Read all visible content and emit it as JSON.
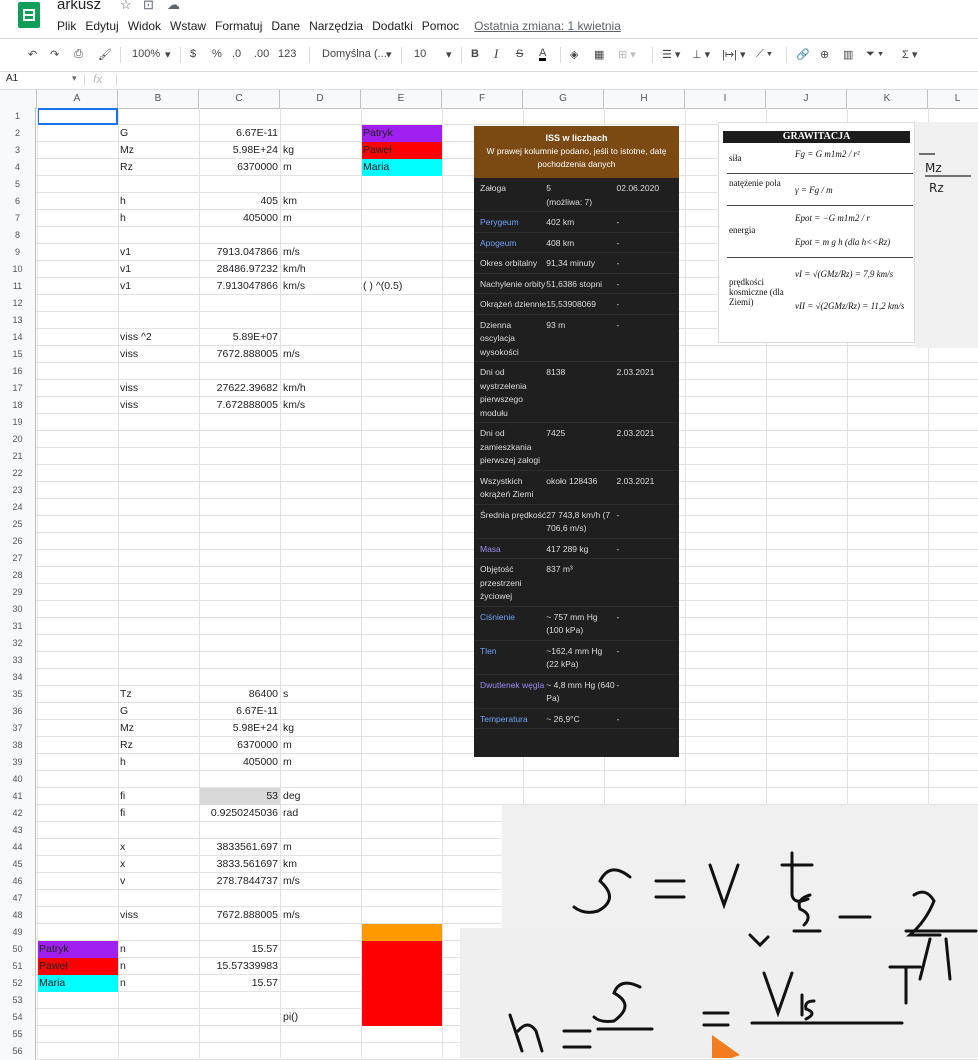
{
  "doc": {
    "title": "arkusz",
    "last_change": "Ostatnia zmiana: 1 kwietnia",
    "menu": [
      "Plik",
      "Edytuj",
      "Widok",
      "Wstaw",
      "Formatuj",
      "Dane",
      "Narzędzia",
      "Dodatki",
      "Pomoc"
    ]
  },
  "toolbar": {
    "zoom": "100%",
    "currency": "$",
    "percent": "%",
    "dec_less": ".0",
    "dec_more": ".00",
    "format_more": "123",
    "font": "Domyślna (...",
    "font_size": "10",
    "bold": "B",
    "italic": "I",
    "strike": "S",
    "text_color": "A",
    "sum": "Σ"
  },
  "formula_bar": {
    "cell_ref": "A1",
    "fx": "fx"
  },
  "columns": [
    "A",
    "B",
    "C",
    "D",
    "E",
    "F",
    "G",
    "H",
    "I",
    "J",
    "K",
    "L"
  ],
  "rows": [
    "1",
    "2",
    "3",
    "4",
    "5",
    "6",
    "7",
    "8",
    "9",
    "10",
    "11",
    "12",
    "13",
    "14",
    "15",
    "16",
    "17",
    "18",
    "19",
    "20",
    "21",
    "22",
    "23",
    "24",
    "25",
    "26",
    "27",
    "28",
    "29",
    "30",
    "31",
    "32",
    "33",
    "34",
    "35",
    "36",
    "37",
    "38",
    "39",
    "40",
    "41",
    "42",
    "43",
    "44",
    "45",
    "46",
    "47",
    "48",
    "49",
    "50",
    "51",
    "52",
    "53",
    "54",
    "55",
    "56"
  ],
  "cells": {
    "r2": {
      "b": "G",
      "c": "6.67E-11",
      "d": "",
      "e": "Patryk"
    },
    "r3": {
      "b": "Mz",
      "c": "5.98E+24",
      "d": "kg",
      "e": "Paweł"
    },
    "r4": {
      "b": "Rz",
      "c": "6370000",
      "d": "m",
      "e": "Maria"
    },
    "r6": {
      "b": "h",
      "c": "405",
      "d": "km"
    },
    "r7": {
      "b": "h",
      "c": "405000",
      "d": "m"
    },
    "r9": {
      "b": "v1",
      "c": "7913.047866",
      "d": "m/s"
    },
    "r10": {
      "b": "v1",
      "c": "28486.97232",
      "d": "km/h"
    },
    "r11": {
      "b": "v1",
      "c": "7.913047866",
      "d": "km/s",
      "e": "(     ) ^(0.5)"
    },
    "r14": {
      "b": "viss ^2",
      "c": "5.89E+07"
    },
    "r15": {
      "b": "viss",
      "c": "7672.888005",
      "d": "m/s"
    },
    "r17": {
      "b": "viss",
      "c": "27622.39682",
      "d": "km/h"
    },
    "r18": {
      "b": "viss",
      "c": "7.672888005",
      "d": "km/s"
    },
    "r35": {
      "b": "Tz",
      "c": "86400",
      "d": "s"
    },
    "r36": {
      "b": "G",
      "c": "6.67E-11"
    },
    "r37": {
      "b": "Mz",
      "c": "5.98E+24",
      "d": "kg"
    },
    "r38": {
      "b": "Rz",
      "c": "6370000",
      "d": "m"
    },
    "r39": {
      "b": "h",
      "c": "405000",
      "d": "m"
    },
    "r41": {
      "b": "fi",
      "c": "53",
      "d": "deg"
    },
    "r42": {
      "b": "fi",
      "c": "0.9250245036",
      "d": "rad"
    },
    "r44": {
      "b": "x",
      "c": "3833561.697",
      "d": "m"
    },
    "r45": {
      "b": "x",
      "c": "3833.561697",
      "d": "km"
    },
    "r46": {
      "b": "v",
      "c": "278.7844737",
      "d": "m/s"
    },
    "r48": {
      "b": "viss",
      "c": "7672.888005",
      "d": "m/s"
    },
    "r50": {
      "a": "Patryk",
      "b": "n",
      "c": "15.57"
    },
    "r51": {
      "a": "Paweł",
      "b": "n",
      "c": "15.57339983"
    },
    "r52": {
      "a": "Maria",
      "b": "n",
      "c": "15.57"
    },
    "r54": {
      "d": "pi()"
    }
  },
  "colors": {
    "violet": "#a020f0",
    "red": "#ff0000",
    "cyan": "#00ffff",
    "orange": "#ff9900",
    "gray": "#d9d9d9"
  },
  "iss": {
    "title": "ISS w liczbach",
    "subtitle": "W prawej kolumnie podano, jeśli to istotne, datę pochodzenia danych",
    "rows": [
      {
        "label": "Załoga",
        "value": "5",
        "note": "(możliwa: 7)",
        "date": "02.06.2020"
      },
      {
        "label": "Perygeum",
        "value": "402 km",
        "date": "-"
      },
      {
        "label": "Apogeum",
        "value": "408 km",
        "date": "-"
      },
      {
        "label": "Okres orbitalny",
        "value": "91,34 minuty",
        "date": "-"
      },
      {
        "label": "Nachylenie orbity",
        "value": "51,6386 stopni",
        "date": "-"
      },
      {
        "label": "Okrążeń dziennie",
        "value": "15,53908069",
        "date": "-"
      },
      {
        "label": "Dzienna oscylacja wysokości",
        "value": "93 m",
        "date": "-"
      },
      {
        "label": "Dni od wystrzelenia pierwszego modułu",
        "value": "8138",
        "date": "2.03.2021"
      },
      {
        "label": "Dni od zamieszkania pierwszej załogi",
        "value": "7425",
        "date": "2.03.2021"
      },
      {
        "label": "Wszystkich okrążeń Ziemi",
        "value": "około 128436",
        "date": "2.03.2021"
      },
      {
        "label": "Średnia prędkość",
        "value": "27 743,8 km/h (7 706,6 m/s)",
        "date": "-"
      },
      {
        "label": "Masa",
        "value": "417 289 kg",
        "date": "-"
      },
      {
        "label": "Objętość przestrzeni życiowej",
        "value": "837 m³",
        "date": ""
      },
      {
        "label": "Ciśnienie",
        "value": "~ 757 mm Hg (100 kPa)",
        "date": "-"
      },
      {
        "label": "Tlen",
        "value": "~162,4 mm Hg (22 kPa)",
        "date": "-"
      },
      {
        "label": "Dwutlenek węgla",
        "value": "~ 4,8 mm Hg (640 Pa)",
        "date": "-"
      },
      {
        "label": "Temperatura",
        "value": "~ 26,9°C",
        "date": "-"
      }
    ]
  },
  "gravity": {
    "title": "GRAWITACJA",
    "rows": [
      "siła",
      "natężenie pola",
      "energia",
      "prędkości kosmiczne (dla Ziemi)"
    ],
    "f1": "Fg = G m1m2 / r²",
    "f2": "γ = Fg / m",
    "f3": "Epot = −G m1m2 / r",
    "f4": "Epot = m g h   (dla h<<Rz)",
    "f5": "vI = √(GMz/Rz) = 7,9 km/s",
    "f6": "vII = √(2GMz/Rz) = 11,2 km/s"
  }
}
